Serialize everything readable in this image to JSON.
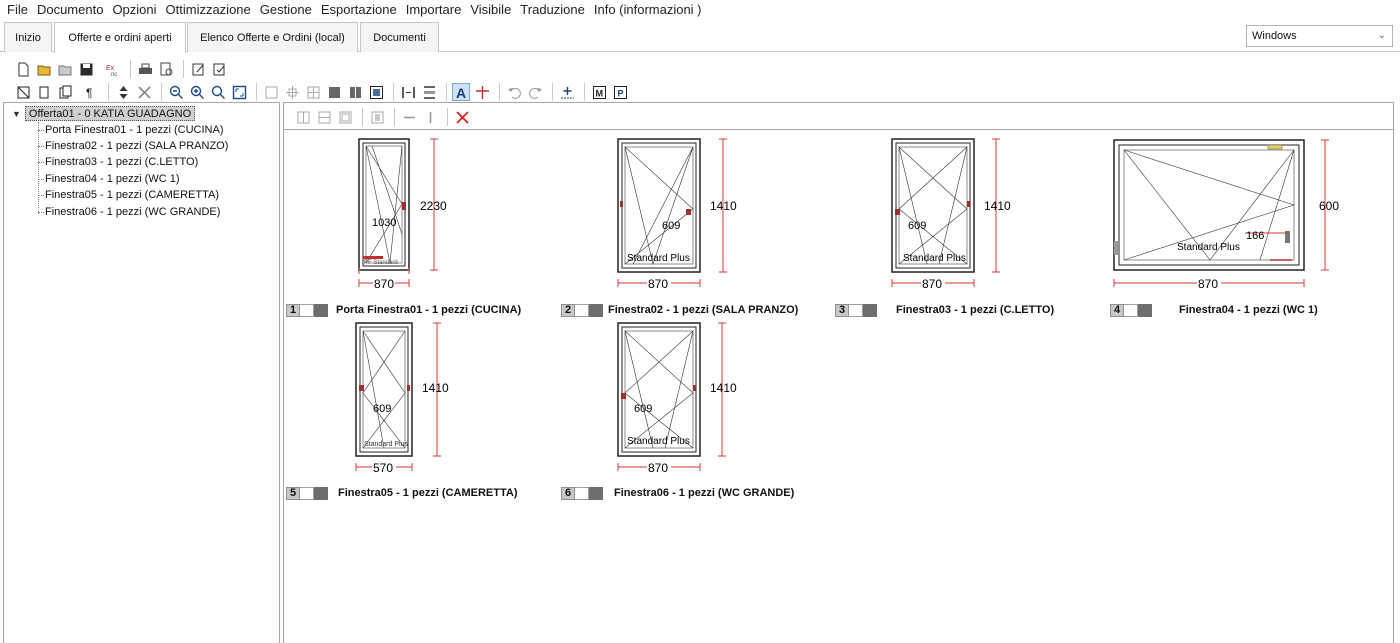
{
  "menu": [
    "File",
    "Documento",
    "Opzioni",
    "Ottimizzazione",
    "Gestione",
    "Esportazione",
    "Importare",
    "Visibile",
    "Traduzione",
    "Info (informazioni )"
  ],
  "tabs": [
    "Inizio",
    "Offerte e ordini aperti",
    "Elenco Offerte e Ordini   (local)",
    "Documenti"
  ],
  "theme_select": {
    "value": "Windows"
  },
  "tree": {
    "root": "Offerta01 - 0  KATIA GUADAGNO",
    "items": [
      "Porta Finestra01 - 1 pezzi (CUCINA)",
      "Finestra02 - 1 pezzi (SALA PRANZO)",
      "Finestra03 - 1 pezzi (C.LETTO)",
      "Finestra04 - 1 pezzi (WC 1)",
      "Finestra05 - 1 pezzi (CAMERETTA)",
      "Finestra06 - 1 pezzi (WC GRANDE)"
    ]
  },
  "windows": [
    {
      "num": "1",
      "title": "Porta Finestra01 - 1 pezzi (CUCINA)",
      "width": "870",
      "height": "2230",
      "sash": "1030",
      "profile": "PF Standard"
    },
    {
      "num": "2",
      "title": "Finestra02 - 1 pezzi (SALA PRANZO)",
      "width": "870",
      "height": "1410",
      "sash": "609",
      "profile": "Standard Plus"
    },
    {
      "num": "3",
      "title": "Finestra03 - 1 pezzi (C.LETTO)",
      "width": "870",
      "height": "1410",
      "sash": "609",
      "profile": "Standard Plus"
    },
    {
      "num": "4",
      "title": "Finestra04 - 1 pezzi (WC 1)",
      "width": "870",
      "height": "600",
      "sash": "166",
      "profile": "Standard Plus"
    },
    {
      "num": "5",
      "title": "Finestra05 - 1 pezzi (CAMERETTA)",
      "width": "570",
      "height": "1410",
      "sash": "609",
      "profile": "Standard Plus"
    },
    {
      "num": "6",
      "title": "Finestra06 - 1 pezzi (WC GRANDE)",
      "width": "870",
      "height": "1410",
      "sash": "609",
      "profile": "Standard Plus"
    }
  ],
  "colors": {
    "dimension": "#d23a3a",
    "frame": "#222222",
    "selected_root": "#d0d0d0"
  },
  "toolbar_icons": {
    "row1": [
      "new-icon",
      "open-icon",
      "open-folder-icon",
      "save-icon",
      "export-icon",
      "print-icon",
      "print-preview-icon",
      "edit-icon",
      "edit-check-icon"
    ],
    "row2": [
      "frame-icon",
      "copy-icon",
      "paste-icon",
      "paragraph-icon",
      "move-updown-icon",
      "delete-icon",
      "zoom-out-icon",
      "zoom-in-icon",
      "zoom-fit-icon",
      "fullscreen-icon",
      "layout-icons",
      "text-icon",
      "dimension-icon",
      "undo-icon",
      "redo-icon",
      "add-point-icon",
      "m-icon",
      "p-icon"
    ],
    "panel": [
      "split-v-icon",
      "split-h-icon",
      "frame-icon",
      "frame2-icon",
      "minus-icon",
      "bar-icon",
      "close-icon"
    ]
  }
}
